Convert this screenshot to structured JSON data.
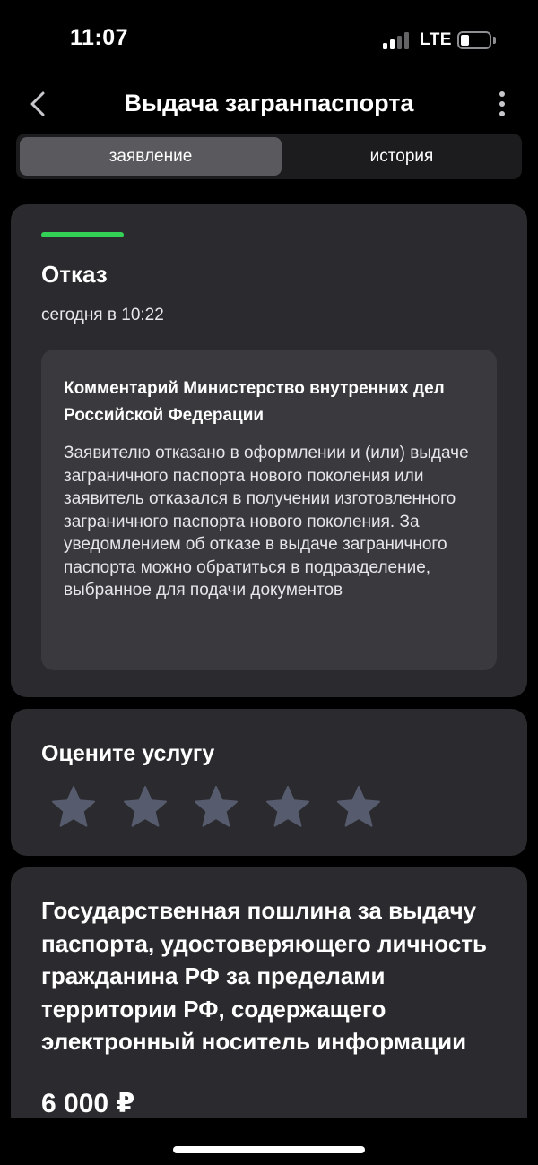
{
  "status_bar": {
    "time": "11:07",
    "network": "LTE",
    "signal_bars_active": 2,
    "battery_level": 0.2
  },
  "nav": {
    "back_icon": "chevron-left-icon",
    "title": "Выдача загранпаспорта",
    "more_icon": "more-vertical-icon"
  },
  "tabs": [
    {
      "label": "заявление",
      "selected": true
    },
    {
      "label": "история",
      "selected": false
    }
  ],
  "status": {
    "accent_color": "#33d155",
    "title": "Отказ",
    "timestamp": "сегодня в 10:22",
    "comment": {
      "title": "Комментарий Министерство внутренних дел Российской Федерации",
      "body": "Заявителю отказано в оформлении и (или) выдаче заграничного паспорта нового поколения или заявитель отказался в получении изготовленного заграничного паспорта нового поколения. За уведомлением об отказе в выдаче заграничного паспорта можно обратиться в подразделение, выбранное для подачи документов"
    }
  },
  "rating": {
    "title": "Оцените услугу",
    "max_stars": 5,
    "selected_stars": 0,
    "star_icon": "star-icon",
    "star_color": "#565c6e"
  },
  "fee": {
    "title": "Государственная пошлина за выдачу паспорта, удостоверяющего личность гражданина РФ за пределами территории РФ, содержащего электронный носитель информации",
    "amount": "6 000 ₽"
  }
}
